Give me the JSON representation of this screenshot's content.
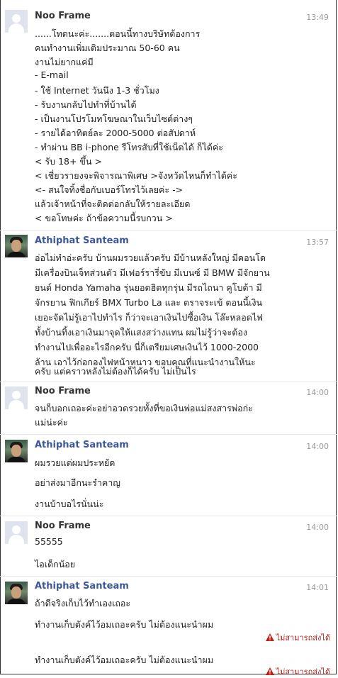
{
  "messages": [
    {
      "sender": "Noo Frame",
      "time": "13:49",
      "lines": [
        "......โทดนะค่ะ.......ตอนนี้ทางบริษัทต้องการ",
        "คนทำงานเพิ่มเติมประมาณ 50-60 คน",
        "งานไม่ยากแค่มี",
        "- E-mail",
        "- ใช้ Internet วันนึง 1-3 ชั่วโมง",
        "- รับงานกลับไปทำที่บ้านได้",
        "- เป็นงานโปรโมทโฆษณาในเว็บไซต์ต่างๆ",
        "- รายได้อาทิตย์ละ 2000-5000 ต่อสัปดาห์",
        "- ทำผ่าน BB i-phone รีโทรสับที่ใช้เน็ตได้ ก็ได้ค่ะ",
        "< รับ 18+ ขึ้น >",
        "< เชี่ยวรายงจะพิจารณาพิเศษ >จังหวัดไหนก็ทำได้ค่ะ",
        "<- สนใจทิ้งชื่อกับเบอร์โทรไว้เลยค่ะ ->",
        "แล้วเจ้าหน้าที่จะติดต่อกลับให้รายละเอียด",
        "< ขอโทษค่ะ ถ้าข้อความนี้รบกวน >"
      ]
    },
    {
      "sender": "Athiphat Santeam",
      "time": "13:57",
      "lines": [
        "อ่อไม่ทำอ่ะครับ บ้านผมรวยแล้วครับ มีบ้านหลังใหญ่ มีคอนโด",
        "มีเครื่องบินเจ็ทส่วนตัว มีเฟอร์รารี่ขับ มีเบนซ์ มี BMW มีจักยาน",
        "ยนต์ Honda Yamaha รุ่นยอดฮิตทุกรุ่น มีรถไถนา คูโบต้า มี",
        "จักรยาน ฟิกเกียร์ BMX Turbo La และ ตราจระเข้ ตอนนี้เงิน",
        "เยอะจัดไม่รู้เอาไปทำไร ก็ว่าจะเอาเงินไปซื้อเงิน โล๊ะหลอดไฟ",
        "ทั้งบ้านทิ้งเอาเงินมาจุดให้แสงสว่างแทน ผมไม่รู้ว่าจะต้อง",
        "ทำงานไปเพื่ออะไรอีกครับ นี่ก็เตรียมเศษเงินไว้ 1000-2000",
        "ล้าน เอาไว้ก่อกองไฟหน้าหนาว ขอบคุณที่แนะนำงานให้นะ",
        "ครับ แต่คราวหลังไม่ต้องก็ได้ครับ ไม่เป็นไร"
      ]
    },
    {
      "sender": "Noo Frame",
      "time": "14:00",
      "lines": [
        "จนก็บอกเถอะค่ะอย่าอวดรวยทั้งที่ขอเงินพ่อแม่สงสารพ่อก่ะ",
        "แม่น่ะค่ะ"
      ]
    },
    {
      "sender": "Athiphat Santeam",
      "time": "14:00",
      "lines": [
        "ผมรวยแต่ผมประหยัด",
        "อย่าส่งมาอีกนะรำคาญ",
        "งานบ้าบอไรนั่นน่ะ"
      ]
    },
    {
      "sender": "Noo Frame",
      "time": "14:00",
      "lines": [
        "55555",
        "ไอเด็กน้อย"
      ]
    },
    {
      "sender": "Athiphat Santeam",
      "time": "14:01",
      "lines": [
        "ถ้าดีจริงเก็บไว้ทำเองเถอะ",
        "ทำงานเก็บตังค์ไว้อมเถอะครับ ไม่ต้องแนะนำผม",
        "ทำงานเก็บตังค์ไว้อมเถอะครับ ไม่ต้องแนะนำผม"
      ],
      "error": "ไม่สามารถส่งได้"
    }
  ],
  "colors": {
    "name_gray": "#333333",
    "name_blue": "#3b5998",
    "time": "#999999",
    "error": "#b0231e"
  }
}
